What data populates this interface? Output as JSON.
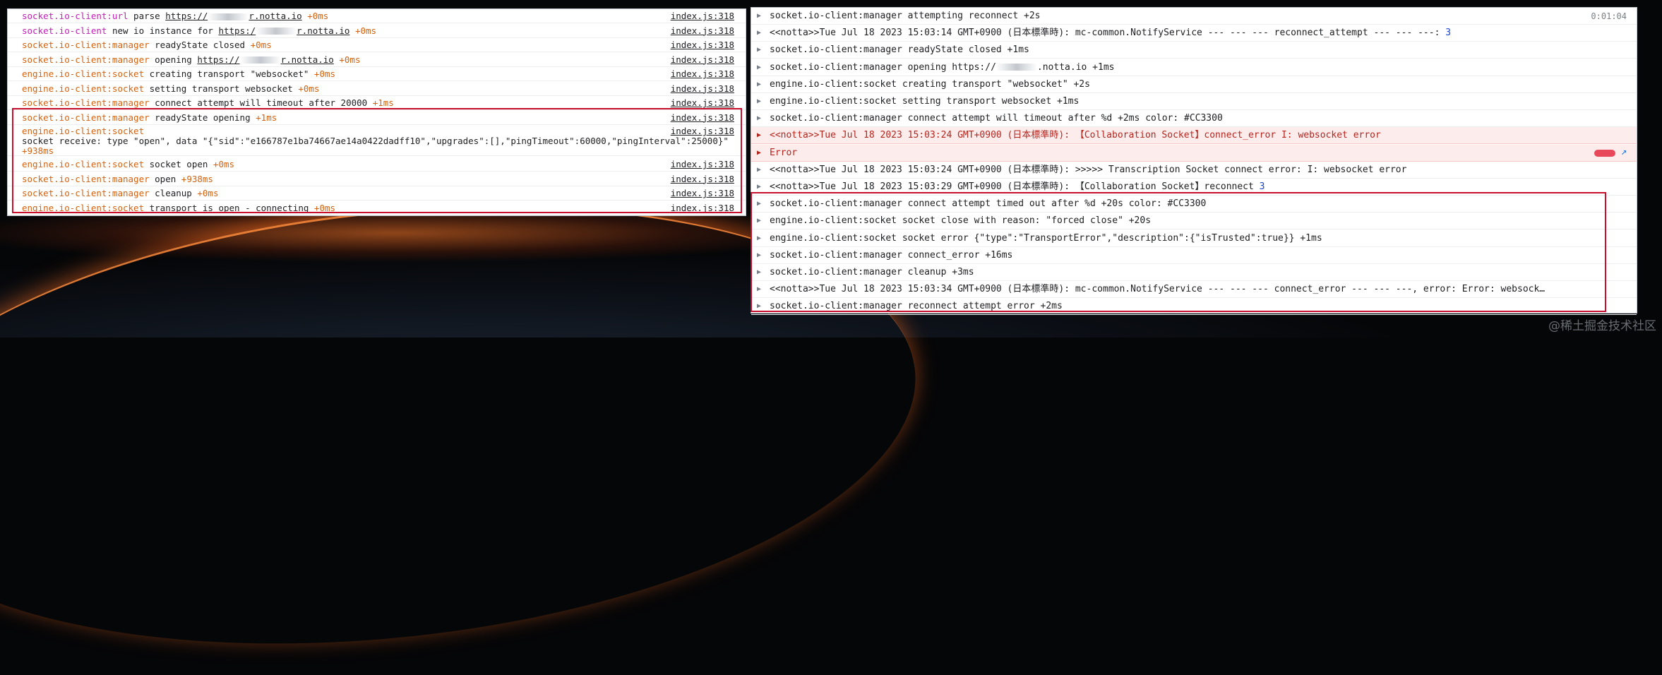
{
  "left_console": {
    "rows": [
      {
        "module": "socket.io-client:url",
        "module_color": "mag",
        "msg_pre": " parse ",
        "url": "https://",
        "url_tail": "r.notta.io",
        "time": " +0ms",
        "source": "index.js:318"
      },
      {
        "module": "socket.io-client",
        "module_color": "mag",
        "msg_pre": " new io instance for ",
        "url": "https:/",
        "url_tail": "r.notta.io",
        "time": " +0ms",
        "source": "index.js:318"
      },
      {
        "module": "socket.io-client:manager",
        "module_color": "org",
        "msg_pre": " readyState closed",
        "url": "",
        "url_tail": "",
        "time": " +0ms",
        "source": "index.js:318"
      },
      {
        "module": "socket.io-client:manager",
        "module_color": "org",
        "msg_pre": " opening ",
        "url": "https://",
        "url_tail": "r.notta.io",
        "time": " +0ms",
        "source": "index.js:318"
      },
      {
        "module": "engine.io-client:socket",
        "module_color": "org",
        "msg_pre": " creating transport \"websocket\"",
        "url": "",
        "url_tail": "",
        "time": " +0ms",
        "source": "index.js:318"
      },
      {
        "module": "engine.io-client:socket",
        "module_color": "org",
        "msg_pre": " setting transport websocket",
        "url": "",
        "url_tail": "",
        "time": " +0ms",
        "source": "index.js:318"
      },
      {
        "module": "socket.io-client:manager",
        "module_color": "org",
        "msg_pre": " connect attempt will timeout after 20000",
        "url": "",
        "url_tail": "",
        "time": " +1ms",
        "source": "index.js:318"
      },
      {
        "module": "socket.io-client:manager",
        "module_color": "org",
        "msg_pre": " readyState opening",
        "url": "",
        "url_tail": "",
        "time": " +1ms",
        "source": "index.js:318"
      }
    ],
    "socket_row": {
      "module": "engine.io-client:socket",
      "line2": "socket receive: type \"open\", data \"{\"sid\":\"e166787e1ba74667ae14a0422dadff10\",\"upgrades\":[],\"pingTimeout\":60000,\"pingInterval\":25000}\"",
      "time": " +938ms",
      "source": "index.js:318"
    },
    "rows_after": [
      {
        "module": "engine.io-client:socket",
        "module_color": "org",
        "msg_pre": " socket open",
        "time": " +0ms",
        "source": "index.js:318"
      },
      {
        "module": "socket.io-client:manager",
        "module_color": "org",
        "msg_pre": " open",
        "time": " +938ms",
        "source": "index.js:318"
      },
      {
        "module": "socket.io-client:manager",
        "module_color": "org",
        "msg_pre": " cleanup",
        "time": " +0ms",
        "source": "index.js:318"
      },
      {
        "module": "engine.io-client:socket",
        "module_color": "org",
        "msg_pre": " transport is open - connecting",
        "time": " +0ms",
        "source": "index.js:318"
      }
    ]
  },
  "right_console": {
    "timestamp": "0:01:04",
    "rows": [
      {
        "text": "socket.io-client:manager attempting reconnect +2s",
        "count": "",
        "err": false
      },
      {
        "text": "<<notta>>Tue Jul 18 2023 15:03:14 GMT+0900 (日本標準時):  mc-common.NotifyService --- --- --- reconnect_attempt --- --- ---:",
        "count": "3",
        "err": false
      },
      {
        "text": "socket.io-client:manager readyState closed +1ms",
        "count": "",
        "err": false
      },
      {
        "text": "socket.io-client:manager opening https://",
        "tail": ".notta.io +1ms",
        "count": "",
        "err": false
      },
      {
        "text": "engine.io-client:socket creating transport \"websocket\" +2s",
        "count": "",
        "err": false
      },
      {
        "text": "engine.io-client:socket setting transport websocket +1ms",
        "count": "",
        "err": false
      },
      {
        "text": "socket.io-client:manager connect attempt will timeout after %d +2ms  color: #CC3300",
        "count": "",
        "err": false
      },
      {
        "text": "<<notta>>Tue Jul 18 2023 15:03:24 GMT+0900 (日本標準時):  【Collaboration Socket】connect_error  I: websocket error",
        "count": "",
        "err": true
      },
      {
        "text": "Error",
        "count": "",
        "err": true
      },
      {
        "text": "<<notta>>Tue Jul 18 2023 15:03:24 GMT+0900 (日本標準時):  >>>>> Transcription Socket connect error:  I: websocket error",
        "count": "",
        "err": false
      },
      {
        "text": "<<notta>>Tue Jul 18 2023 15:03:29 GMT+0900 (日本標準時):  【Collaboration Socket】reconnect",
        "count": "3",
        "err": false
      },
      {
        "text": "socket.io-client:manager connect attempt timed out after %d +20s  color: #CC3300",
        "count": "",
        "err": false
      },
      {
        "text": "engine.io-client:socket socket close with reason: \"forced close\" +20s",
        "count": "",
        "err": false
      },
      {
        "text": "engine.io-client:socket socket error {\"type\":\"TransportError\",\"description\":{\"isTrusted\":true}} +1ms",
        "count": "",
        "err": false
      },
      {
        "text": "socket.io-client:manager connect_error +16ms",
        "count": "",
        "err": false
      },
      {
        "text": "socket.io-client:manager cleanup +3ms",
        "count": "",
        "err": false
      },
      {
        "text": "<<notta>>Tue Jul 18 2023 15:03:34 GMT+0900 (日本標準時):  mc-common.NotifyService --- --- --- connect_error --- --- ---, error:    Error: websock…",
        "count": "",
        "err": false
      },
      {
        "text": "socket.io-client:manager reconnect attempt error +2ms",
        "count": "",
        "err": false
      }
    ]
  },
  "watermark": "@稀土掘金技术社区",
  "colors": {
    "highlight_border": "#c8102e",
    "error_bg": "#fdecec",
    "module_orange": "#d46210",
    "module_magenta": "#c01fb6",
    "count_blue": "#1a46c8"
  }
}
